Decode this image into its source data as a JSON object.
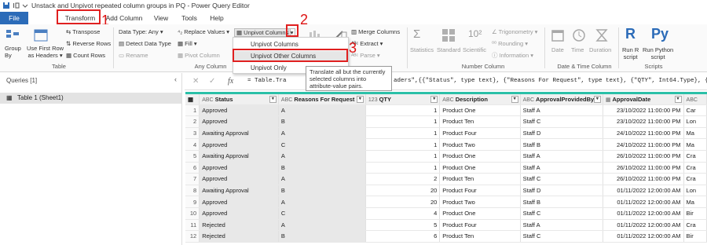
{
  "window": {
    "title": "Unstack and Unpivot repeated column groups in PQ - Power Query Editor"
  },
  "menu": {
    "tabs": [
      "File",
      "Transform",
      "Add Column",
      "View",
      "Tools",
      "Help"
    ]
  },
  "annotations": {
    "n1": "1",
    "n2": "2",
    "n3": "3"
  },
  "ribbon": {
    "table_group": {
      "label": "Table",
      "group_by": [
        "Group",
        "By"
      ],
      "first_row": [
        "Use First Row",
        "as Headers"
      ],
      "transpose": "Transpose",
      "reverse": "Reverse Rows",
      "count": "Count Rows"
    },
    "any_column": {
      "label": "Any Column",
      "data_type": "Data Type: Any",
      "detect": "Detect Data Type",
      "rename": "Rename",
      "replace": "Replace Values",
      "fill": "Fill",
      "pivot": "Pivot Column",
      "unpivot": "Unpivot Columns"
    },
    "text_column": {
      "merge": "Merge Columns",
      "extract": "Extract",
      "parse": "Parse"
    },
    "number_column": {
      "label": "Number Column",
      "statistics": "Statistics",
      "standard": "Standard",
      "scientific": "Scientific",
      "trig": "Trigonometry",
      "rounding": "Rounding",
      "information": "Information"
    },
    "datetime": {
      "label": "Date & Time Column",
      "date": "Date",
      "time": "Time",
      "duration": "Duration"
    },
    "scripts": {
      "label": "Scripts",
      "r": [
        "Run R",
        "script"
      ],
      "py": [
        "Run Python",
        "script"
      ]
    }
  },
  "dropdown": {
    "items": [
      "Unpivot Columns",
      "Unpivot Other Columns",
      "Unpivot Only"
    ]
  },
  "tooltip": {
    "text": "Translate all but the currently selected columns into attribute-value pairs."
  },
  "queries": {
    "header": "Queries [1]",
    "items": [
      "Table 1 (Sheet1)"
    ]
  },
  "formula": {
    "fx": "fx",
    "text": "= Table.Tra",
    "text_end": "aders\",{{\"Status\", type text}, {\"Reasons For Request\", type text}, {\"QTY\", Int64.Type}, {\"Desc"
  },
  "table": {
    "columns": [
      {
        "type": "ABC",
        "name": "Status"
      },
      {
        "type": "ABC",
        "name": "Reasons For Request"
      },
      {
        "type": "123",
        "name": "QTY"
      },
      {
        "type": "ABC",
        "name": "Description"
      },
      {
        "type": "ABC",
        "name": "ApprovalProvidedBy"
      },
      {
        "type": "cal",
        "name": "ApprovalDate"
      },
      {
        "type": "ABC",
        "name": ""
      }
    ],
    "rows": [
      [
        "1",
        "Approved",
        "A",
        "1",
        "Product One",
        "Staff A",
        "23/10/2022 11:00:00 PM",
        "Car"
      ],
      [
        "2",
        "Approved",
        "B",
        "1",
        "Product Ten",
        "Staff C",
        "23/10/2022 11:00:00 PM",
        "Lon"
      ],
      [
        "3",
        "Awaiting Approval",
        "A",
        "1",
        "Product Four",
        "Staff D",
        "24/10/2022 11:00:00 PM",
        "Ma"
      ],
      [
        "4",
        "Approved",
        "C",
        "1",
        "Product Two",
        "Staff B",
        "24/10/2022 11:00:00 PM",
        "Ma"
      ],
      [
        "5",
        "Awaiting Approval",
        "A",
        "1",
        "Product One",
        "Staff A",
        "26/10/2022 11:00:00 PM",
        "Cra"
      ],
      [
        "6",
        "Approved",
        "B",
        "1",
        "Product One",
        "Staff A",
        "26/10/2022 11:00:00 PM",
        "Cra"
      ],
      [
        "7",
        "Approved",
        "A",
        "2",
        "Product Ten",
        "Staff C",
        "26/10/2022 11:00:00 PM",
        "Cra"
      ],
      [
        "8",
        "Awaiting Approval",
        "B",
        "20",
        "Product Four",
        "Staff D",
        "01/11/2022 12:00:00 AM",
        "Lon"
      ],
      [
        "9",
        "Approved",
        "A",
        "20",
        "Product Two",
        "Staff B",
        "01/11/2022 12:00:00 AM",
        "Ma"
      ],
      [
        "10",
        "Approved",
        "C",
        "4",
        "Product One",
        "Staff C",
        "01/11/2022 12:00:00 AM",
        "Bir"
      ],
      [
        "11",
        "Rejected",
        "A",
        "5",
        "Product Four",
        "Staff A",
        "01/11/2022 12:00:00 AM",
        "Cra"
      ],
      [
        "12",
        "Rejected",
        "B",
        "6",
        "Product Ten",
        "Staff C",
        "01/11/2022 12:00:00 AM",
        "Bir"
      ]
    ]
  }
}
